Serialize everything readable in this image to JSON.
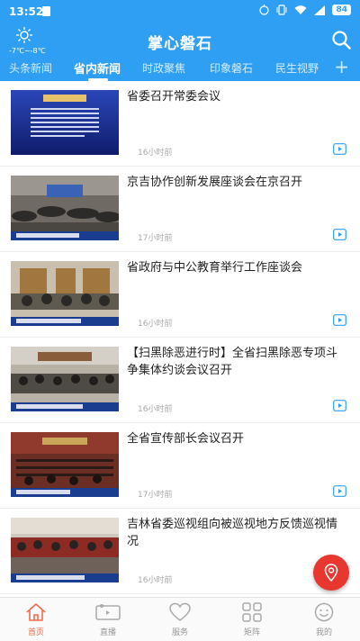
{
  "status": {
    "time": "13:52",
    "battery": "84"
  },
  "header": {
    "weather_icon": "sun-icon",
    "weather_temp": "-7℃~-8℃",
    "title": "掌心磐石"
  },
  "tabs": [
    {
      "label": "头条新闻",
      "active": false
    },
    {
      "label": "省内新闻",
      "active": true
    },
    {
      "label": "时政聚焦",
      "active": false
    },
    {
      "label": "印象磐石",
      "active": false
    },
    {
      "label": "民生视野",
      "active": false
    }
  ],
  "news": [
    {
      "title": "省委召开常委会议",
      "time": "16小时前",
      "thumb_caption": "省委召开常委会议"
    },
    {
      "title": "京吉协作创新发展座谈会在京召开",
      "time": "17小时前"
    },
    {
      "title": "省政府与中公教育举行工作座谈会",
      "time": "16小时前"
    },
    {
      "title": "【扫黑除恶进行时】全省扫黑除恶专项斗争集体约谈会议召开",
      "time": "16小时前"
    },
    {
      "title": "全省宣传部长会议召开",
      "time": "17小时前"
    },
    {
      "title": "吉林省委巡视组向被巡视地方反馈巡视情况",
      "time": "16小时前"
    }
  ],
  "bottom_nav": [
    {
      "label": "首页",
      "icon": "home-icon",
      "active": true
    },
    {
      "label": "直播",
      "icon": "video-camera-icon",
      "active": false
    },
    {
      "label": "服务",
      "icon": "heart-icon",
      "active": false
    },
    {
      "label": "矩阵",
      "icon": "grid-icon",
      "active": false
    },
    {
      "label": "我的",
      "icon": "smiley-icon",
      "active": false
    }
  ],
  "colors": {
    "primary": "#2f9ff3",
    "accent_red": "#e8372e",
    "nav_active": "#f26b4b"
  }
}
